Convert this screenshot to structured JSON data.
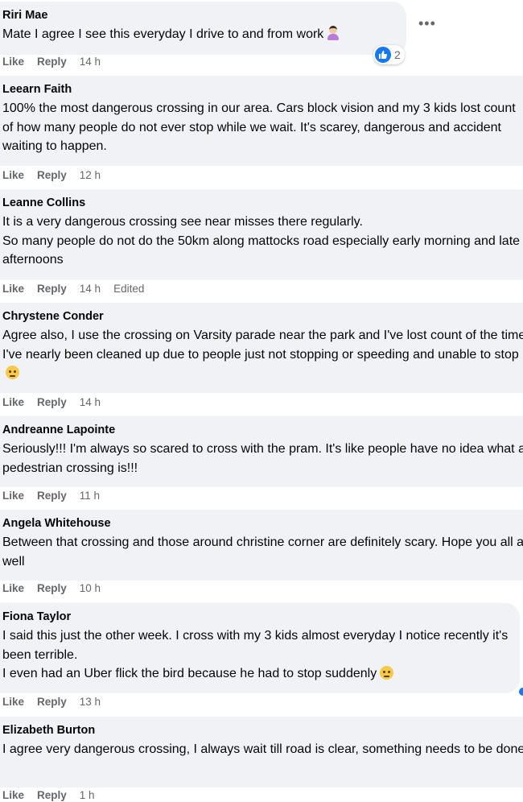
{
  "comments": [
    {
      "author": "Riri Mae",
      "text": "Mate I agree I see this everyday I drive to and from work",
      "like": "Like",
      "reply": "Reply",
      "time": "14 h",
      "reactions": "2"
    },
    {
      "author": "Leearn Faith",
      "text": "100% the most dangerous crossing in our area. Cars block vision and my 3 kids lost count of how many people do not ever stop while we wait. It's scarey, dangerous and accident waiting to happen.",
      "like": "Like",
      "reply": "Reply",
      "time": "12 h"
    },
    {
      "author": "Leanne Collins",
      "text": "It is a very dangerous crossing see near misses there regularly.\nSo many people do not do the 50km along mattocks road especially early morning and late afternoons",
      "like": "Like",
      "reply": "Reply",
      "time": "14 h",
      "edited": "Edited"
    },
    {
      "author": "Chrystene Conder",
      "text": "Agree also, I use the crossing on Varsity parade near the park and I've lost count of the times I've nearly been cleaned up due to people just not stopping or speeding and unable to stop",
      "like": "Like",
      "reply": "Reply",
      "time": "14 h"
    },
    {
      "author": "Andreanne Lapointe",
      "text": "Seriously!!! I'm always so scared to cross with the pram. It's like people have no idea what a pedestrian crossing is!!!",
      "like": "Like",
      "reply": "Reply",
      "time": "11 h"
    },
    {
      "author": "Angela Whitehouse",
      "text": "Between that crossing and those around christine corner are definitely scary. Hope you all are well",
      "like": "Like",
      "reply": "Reply",
      "time": "10 h"
    },
    {
      "author": "Fiona Taylor",
      "text": "I said this just the other week. I cross with my 3 kids almost everyday I notice recently it's been terrible.\nI even had an Uber flick the bird because he had to stop suddenly",
      "like": "Like",
      "reply": "Reply",
      "time": "13 h"
    },
    {
      "author": "Elizabeth Burton",
      "text": "I agree very dangerous crossing, I always wait till road is clear, something needs to be done",
      "like": "Like",
      "reply": "Reply",
      "time": "1 h"
    }
  ],
  "icons": {
    "more": "more-options-icon",
    "like_reaction": "like-reaction-icon",
    "emoji_person": "person-emoji-icon",
    "emoji_face": "grimace-emoji-icon"
  },
  "colors": {
    "bubble": "#f0f2f5",
    "meta": "#65676b",
    "like_blue": "#1877f2"
  }
}
